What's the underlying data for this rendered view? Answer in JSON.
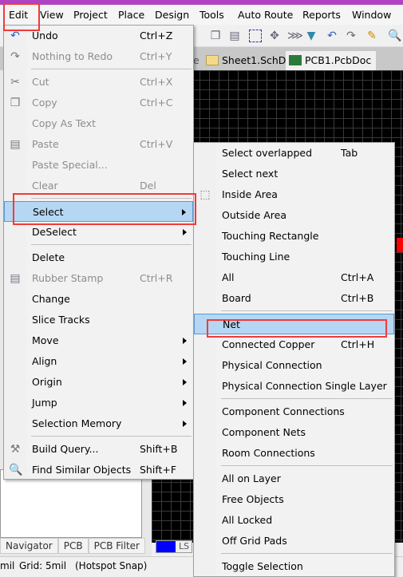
{
  "menubar": {
    "items": [
      "Edit",
      "View",
      "Project",
      "Place",
      "Design",
      "Tools",
      "Auto Route",
      "Reports",
      "Window"
    ]
  },
  "tabs": {
    "partial": "e",
    "sheet": "Sheet1.SchDoc",
    "pcb": "PCB1.PcbDoc"
  },
  "panel_tabs": [
    "Navigator",
    "PCB",
    "PCB Filter"
  ],
  "layer": {
    "label": "LS",
    "color": "#0000ff"
  },
  "status": {
    "unit": "mil",
    "grid": "Grid: 5mil",
    "snap": "(Hotspot Snap)"
  },
  "edit_menu": [
    {
      "label": "Undo",
      "shortcut": "Ctrl+Z",
      "icon": "undo-icon"
    },
    {
      "label": "Nothing to Redo",
      "shortcut": "Ctrl+Y",
      "icon": "redo-icon",
      "disabled": true
    },
    {
      "sep": true
    },
    {
      "label": "Cut",
      "shortcut": "Ctrl+X",
      "icon": "scissors-icon",
      "disabled": true
    },
    {
      "label": "Copy",
      "shortcut": "Ctrl+C",
      "icon": "copy-icon",
      "disabled": true
    },
    {
      "label": "Copy As Text",
      "disabled": true
    },
    {
      "label": "Paste",
      "shortcut": "Ctrl+V",
      "icon": "paste-icon",
      "disabled": true
    },
    {
      "label": "Paste Special...",
      "disabled": true
    },
    {
      "label": "Clear",
      "shortcut": "Del",
      "disabled": true
    },
    {
      "sep": true
    },
    {
      "label": "Select",
      "submenu": true,
      "highlighted": true
    },
    {
      "label": "DeSelect",
      "submenu": true
    },
    {
      "sep": true
    },
    {
      "label": "Delete"
    },
    {
      "label": "Rubber Stamp",
      "shortcut": "Ctrl+R",
      "icon": "rubber-stamp-icon",
      "disabled": true
    },
    {
      "label": "Change"
    },
    {
      "label": "Slice Tracks"
    },
    {
      "label": "Move",
      "submenu": true
    },
    {
      "label": "Align",
      "submenu": true
    },
    {
      "label": "Origin",
      "submenu": true
    },
    {
      "label": "Jump",
      "submenu": true
    },
    {
      "label": "Selection Memory",
      "submenu": true
    },
    {
      "sep": true
    },
    {
      "label": "Build Query...",
      "shortcut": "Shift+B",
      "icon": "build-query-icon"
    },
    {
      "label": "Find Similar Objects",
      "shortcut": "Shift+F",
      "icon": "magnifier-icon"
    }
  ],
  "select_menu": [
    {
      "label": "Select overlapped",
      "shortcut": "Tab"
    },
    {
      "label": "Select next"
    },
    {
      "label": "Inside Area",
      "icon": "dashed-rect-icon"
    },
    {
      "label": "Outside Area"
    },
    {
      "label": "Touching Rectangle"
    },
    {
      "label": "Touching Line"
    },
    {
      "label": "All",
      "shortcut": "Ctrl+A"
    },
    {
      "label": "Board",
      "shortcut": "Ctrl+B"
    },
    {
      "sep": true
    },
    {
      "label": "Net",
      "highlighted": true
    },
    {
      "label": "Connected Copper",
      "shortcut": "Ctrl+H"
    },
    {
      "label": "Physical Connection"
    },
    {
      "label": "Physical Connection Single Layer"
    },
    {
      "sep": true
    },
    {
      "label": "Component Connections"
    },
    {
      "label": "Component Nets"
    },
    {
      "label": "Room Connections"
    },
    {
      "sep": true
    },
    {
      "label": "All on Layer"
    },
    {
      "label": "Free Objects"
    },
    {
      "label": "All Locked"
    },
    {
      "label": "Off Grid Pads"
    },
    {
      "sep": true
    },
    {
      "label": "Toggle Selection"
    }
  ],
  "colors": {
    "highlight": "#b5d7f3",
    "annotation_red": "#f23a3a"
  }
}
